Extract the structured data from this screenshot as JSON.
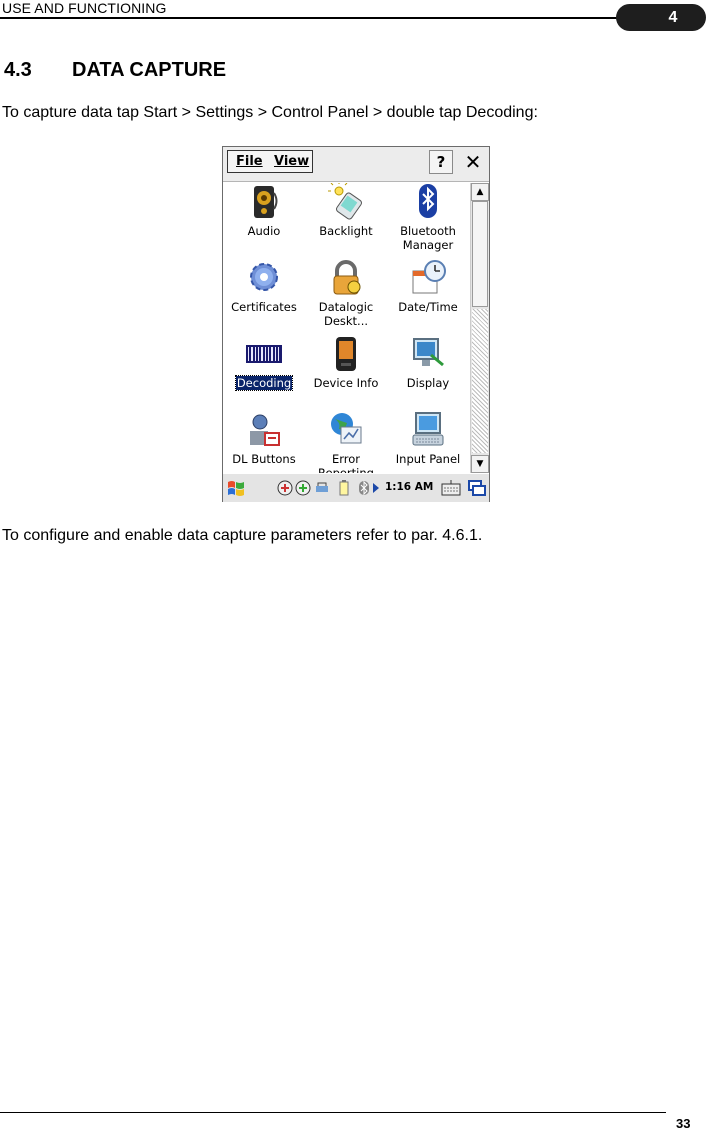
{
  "header": {
    "section": "USE AND FUNCTIONING",
    "chapter": "4"
  },
  "title": {
    "number": "4.3",
    "text": "DATA CAPTURE"
  },
  "intro": "To capture data tap Start > Settings > Control Panel > double tap Decoding:",
  "device": {
    "menu": {
      "file": "File",
      "view": "View"
    },
    "help_label": "?",
    "close_label": "✕",
    "items": [
      {
        "label": "Audio",
        "icon": "speaker-icon"
      },
      {
        "label": "Backlight",
        "icon": "backlight-icon"
      },
      {
        "label": "Bluetooth Manager",
        "icon": "bluetooth-icon"
      },
      {
        "label": "Certificates",
        "icon": "gear-certificates-icon"
      },
      {
        "label": "Datalogic Deskt...",
        "icon": "datalogic-desktop-icon"
      },
      {
        "label": "Date/Time",
        "icon": "calendar-clock-icon"
      },
      {
        "label": "Decoding",
        "icon": "barcode-icon",
        "selected": true
      },
      {
        "label": "Device Info",
        "icon": "device-icon"
      },
      {
        "label": "Display",
        "icon": "display-icon"
      },
      {
        "label": "DL Buttons",
        "icon": "dl-buttons-icon"
      },
      {
        "label": "Error Reporting",
        "icon": "globe-icon"
      },
      {
        "label": "Input Panel",
        "icon": "keyboard-monitor-icon"
      }
    ],
    "clock": "1:16 AM"
  },
  "outro": "To configure and enable data capture parameters refer to par. 4.6.1.",
  "page_number": "33",
  "colors": {
    "selection": "#0a246a",
    "badge": "#1e1e1e"
  }
}
